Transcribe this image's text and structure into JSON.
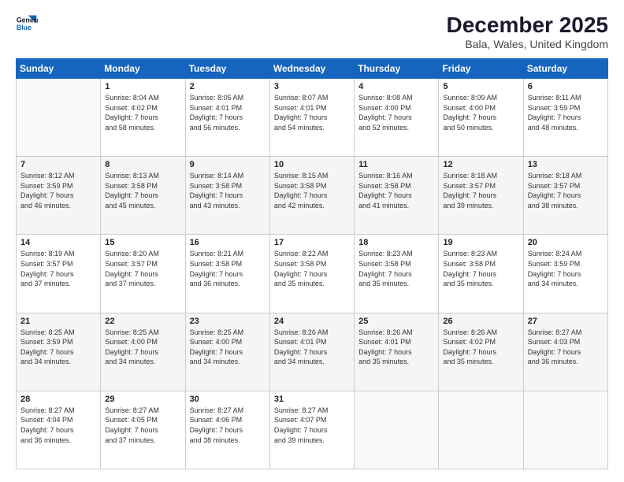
{
  "header": {
    "logo_line1": "General",
    "logo_line2": "Blue",
    "month_title": "December 2025",
    "location": "Bala, Wales, United Kingdom"
  },
  "weekdays": [
    "Sunday",
    "Monday",
    "Tuesday",
    "Wednesday",
    "Thursday",
    "Friday",
    "Saturday"
  ],
  "weeks": [
    [
      {
        "num": "",
        "info": ""
      },
      {
        "num": "1",
        "info": "Sunrise: 8:04 AM\nSunset: 4:02 PM\nDaylight: 7 hours\nand 58 minutes."
      },
      {
        "num": "2",
        "info": "Sunrise: 8:05 AM\nSunset: 4:01 PM\nDaylight: 7 hours\nand 56 minutes."
      },
      {
        "num": "3",
        "info": "Sunrise: 8:07 AM\nSunset: 4:01 PM\nDaylight: 7 hours\nand 54 minutes."
      },
      {
        "num": "4",
        "info": "Sunrise: 8:08 AM\nSunset: 4:00 PM\nDaylight: 7 hours\nand 52 minutes."
      },
      {
        "num": "5",
        "info": "Sunrise: 8:09 AM\nSunset: 4:00 PM\nDaylight: 7 hours\nand 50 minutes."
      },
      {
        "num": "6",
        "info": "Sunrise: 8:11 AM\nSunset: 3:59 PM\nDaylight: 7 hours\nand 48 minutes."
      }
    ],
    [
      {
        "num": "7",
        "info": "Sunrise: 8:12 AM\nSunset: 3:59 PM\nDaylight: 7 hours\nand 46 minutes."
      },
      {
        "num": "8",
        "info": "Sunrise: 8:13 AM\nSunset: 3:58 PM\nDaylight: 7 hours\nand 45 minutes."
      },
      {
        "num": "9",
        "info": "Sunrise: 8:14 AM\nSunset: 3:58 PM\nDaylight: 7 hours\nand 43 minutes."
      },
      {
        "num": "10",
        "info": "Sunrise: 8:15 AM\nSunset: 3:58 PM\nDaylight: 7 hours\nand 42 minutes."
      },
      {
        "num": "11",
        "info": "Sunrise: 8:16 AM\nSunset: 3:58 PM\nDaylight: 7 hours\nand 41 minutes."
      },
      {
        "num": "12",
        "info": "Sunrise: 8:18 AM\nSunset: 3:57 PM\nDaylight: 7 hours\nand 39 minutes."
      },
      {
        "num": "13",
        "info": "Sunrise: 8:18 AM\nSunset: 3:57 PM\nDaylight: 7 hours\nand 38 minutes."
      }
    ],
    [
      {
        "num": "14",
        "info": "Sunrise: 8:19 AM\nSunset: 3:57 PM\nDaylight: 7 hours\nand 37 minutes."
      },
      {
        "num": "15",
        "info": "Sunrise: 8:20 AM\nSunset: 3:57 PM\nDaylight: 7 hours\nand 37 minutes."
      },
      {
        "num": "16",
        "info": "Sunrise: 8:21 AM\nSunset: 3:58 PM\nDaylight: 7 hours\nand 36 minutes."
      },
      {
        "num": "17",
        "info": "Sunrise: 8:22 AM\nSunset: 3:58 PM\nDaylight: 7 hours\nand 35 minutes."
      },
      {
        "num": "18",
        "info": "Sunrise: 8:23 AM\nSunset: 3:58 PM\nDaylight: 7 hours\nand 35 minutes."
      },
      {
        "num": "19",
        "info": "Sunrise: 8:23 AM\nSunset: 3:58 PM\nDaylight: 7 hours\nand 35 minutes."
      },
      {
        "num": "20",
        "info": "Sunrise: 8:24 AM\nSunset: 3:59 PM\nDaylight: 7 hours\nand 34 minutes."
      }
    ],
    [
      {
        "num": "21",
        "info": "Sunrise: 8:25 AM\nSunset: 3:59 PM\nDaylight: 7 hours\nand 34 minutes."
      },
      {
        "num": "22",
        "info": "Sunrise: 8:25 AM\nSunset: 4:00 PM\nDaylight: 7 hours\nand 34 minutes."
      },
      {
        "num": "23",
        "info": "Sunrise: 8:25 AM\nSunset: 4:00 PM\nDaylight: 7 hours\nand 34 minutes."
      },
      {
        "num": "24",
        "info": "Sunrise: 8:26 AM\nSunset: 4:01 PM\nDaylight: 7 hours\nand 34 minutes."
      },
      {
        "num": "25",
        "info": "Sunrise: 8:26 AM\nSunset: 4:01 PM\nDaylight: 7 hours\nand 35 minutes."
      },
      {
        "num": "26",
        "info": "Sunrise: 8:26 AM\nSunset: 4:02 PM\nDaylight: 7 hours\nand 35 minutes."
      },
      {
        "num": "27",
        "info": "Sunrise: 8:27 AM\nSunset: 4:03 PM\nDaylight: 7 hours\nand 36 minutes."
      }
    ],
    [
      {
        "num": "28",
        "info": "Sunrise: 8:27 AM\nSunset: 4:04 PM\nDaylight: 7 hours\nand 36 minutes."
      },
      {
        "num": "29",
        "info": "Sunrise: 8:27 AM\nSunset: 4:05 PM\nDaylight: 7 hours\nand 37 minutes."
      },
      {
        "num": "30",
        "info": "Sunrise: 8:27 AM\nSunset: 4:06 PM\nDaylight: 7 hours\nand 38 minutes."
      },
      {
        "num": "31",
        "info": "Sunrise: 8:27 AM\nSunset: 4:07 PM\nDaylight: 7 hours\nand 39 minutes."
      },
      {
        "num": "",
        "info": ""
      },
      {
        "num": "",
        "info": ""
      },
      {
        "num": "",
        "info": ""
      }
    ]
  ]
}
